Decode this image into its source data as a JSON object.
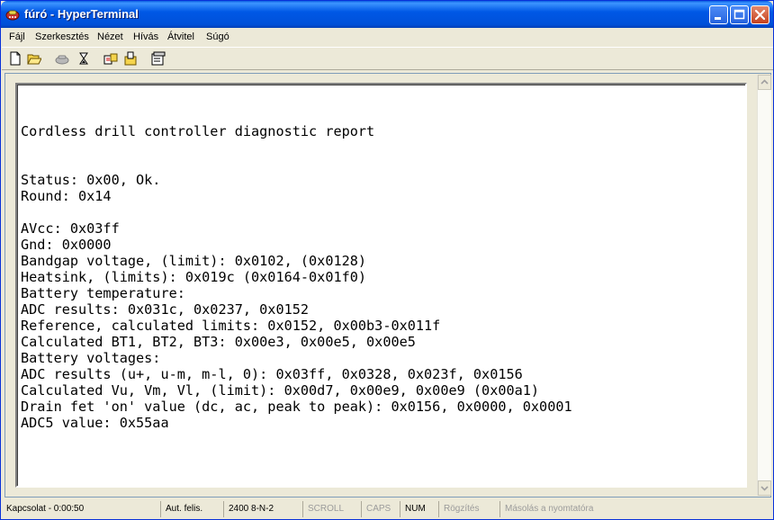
{
  "window": {
    "title": "fúró - HyperTerminal",
    "minimize_label": "",
    "accent": "#0058e6"
  },
  "menu": {
    "items": [
      "Fájl",
      "Szerkesztés",
      "Nézet",
      "Hívás",
      "Átvitel",
      "Súgó"
    ]
  },
  "toolbar": {
    "icons": [
      "new-file-icon",
      "open-folder-icon",
      "phone-icon",
      "disconnect-icon",
      "send-icon",
      "receive-icon",
      "properties-icon"
    ]
  },
  "terminal": {
    "lines": [
      "Cordless drill controller diagnostic report",
      "",
      "",
      "Status: 0x00, Ok.",
      "Round: 0x14",
      "",
      "AVcc: 0x03ff",
      "Gnd: 0x0000",
      "Bandgap voltage, (limit): 0x0102, (0x0128)",
      "Heatsink, (limits): 0x019c (0x0164-0x01f0)",
      "Battery temperature:",
      "ADC results: 0x031c, 0x0237, 0x0152",
      "Reference, calculated limits: 0x0152, 0x00b3-0x011f",
      "Calculated BT1, BT2, BT3: 0x00e3, 0x00e5, 0x00e5",
      "Battery voltages:",
      "ADC results (u+, u-m, m-l, 0): 0x03ff, 0x0328, 0x023f, 0x0156",
      "Calculated Vu, Vm, Vl, (limit): 0x00d7, 0x00e9, 0x00e9 (0x00a1)",
      "Drain fet 'on' value (dc, ac, peak to peak): 0x0156, 0x0000, 0x0001",
      "ADC5 value: 0x55aa"
    ]
  },
  "status": {
    "connection": "Kapcsolat - 0:00:50",
    "detect": "Aut. felis.",
    "settings": "2400 8-N-2",
    "scroll": "SCROLL",
    "caps": "CAPS",
    "num": "NUM",
    "capture": "Rögzítés",
    "print_echo": "Másolás a nyomtatóra"
  }
}
